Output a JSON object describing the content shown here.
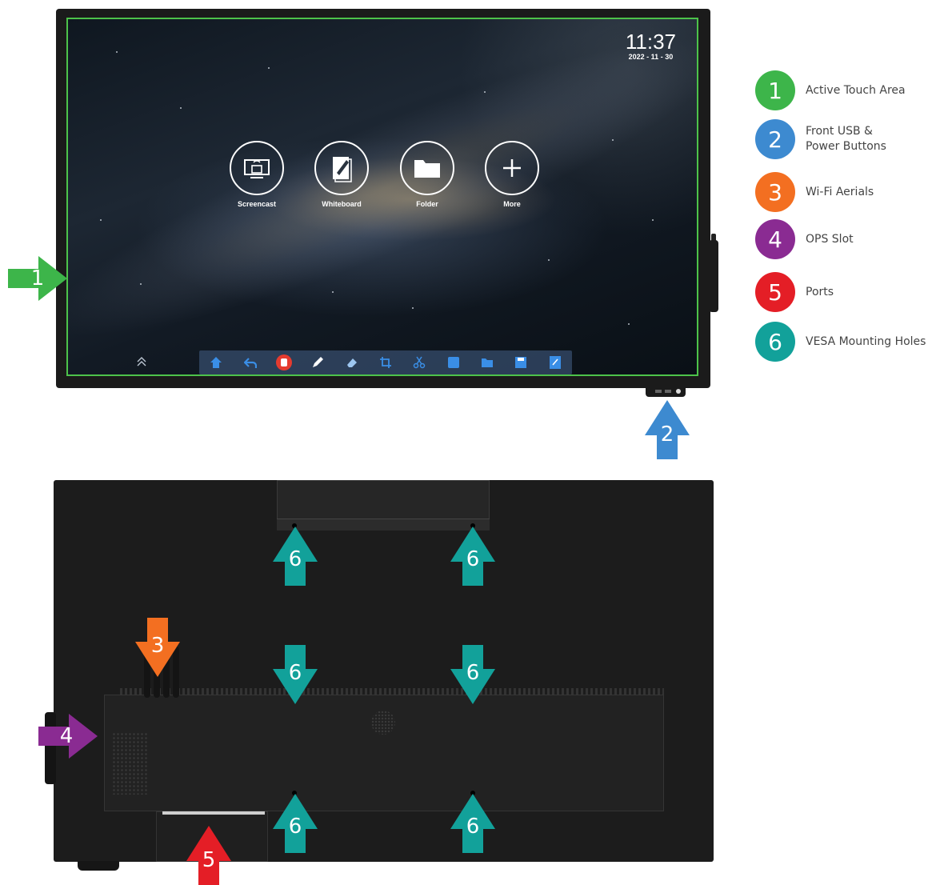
{
  "screen": {
    "time": "11:37",
    "date": "2022 - 11 - 30",
    "apps": [
      {
        "label": "Screencast",
        "icon": "screencast-icon"
      },
      {
        "label": "Whiteboard",
        "icon": "whiteboard-icon"
      },
      {
        "label": "Folder",
        "icon": "folder-icon"
      },
      {
        "label": "More",
        "icon": "plus-icon"
      }
    ],
    "toolbar_icons": [
      "home-icon",
      "back-icon",
      "hand-icon",
      "pen-icon",
      "eraser-icon",
      "crop-icon",
      "scissors-icon",
      "window-icon",
      "folder-icon",
      "save-icon",
      "note-icon"
    ]
  },
  "legend": {
    "items": [
      {
        "number": "1",
        "label": "Active Touch Area",
        "color": "#3db54a"
      },
      {
        "number": "2",
        "label": "Front USB & Power Buttons",
        "color": "#3d8ad0"
      },
      {
        "number": "3",
        "label": "Wi-Fi Aerials",
        "color": "#f36f21"
      },
      {
        "number": "4",
        "label": "OPS Slot",
        "color": "#8a2b92"
      },
      {
        "number": "5",
        "label": "Ports",
        "color": "#e41e26"
      },
      {
        "number": "6",
        "label": "VESA Mounting Holes",
        "color": "#12a19a"
      }
    ]
  },
  "markers": {
    "m1": "1",
    "m2": "2",
    "m3": "3",
    "m4": "4",
    "m5": "5",
    "m6": "6"
  },
  "colors": {
    "touch_area_border": "#4dc34a",
    "green": "#3db54a",
    "blue": "#3d8ad0",
    "orange": "#f36f21",
    "purple": "#8a2b92",
    "red": "#e41e26",
    "teal": "#12a19a"
  }
}
